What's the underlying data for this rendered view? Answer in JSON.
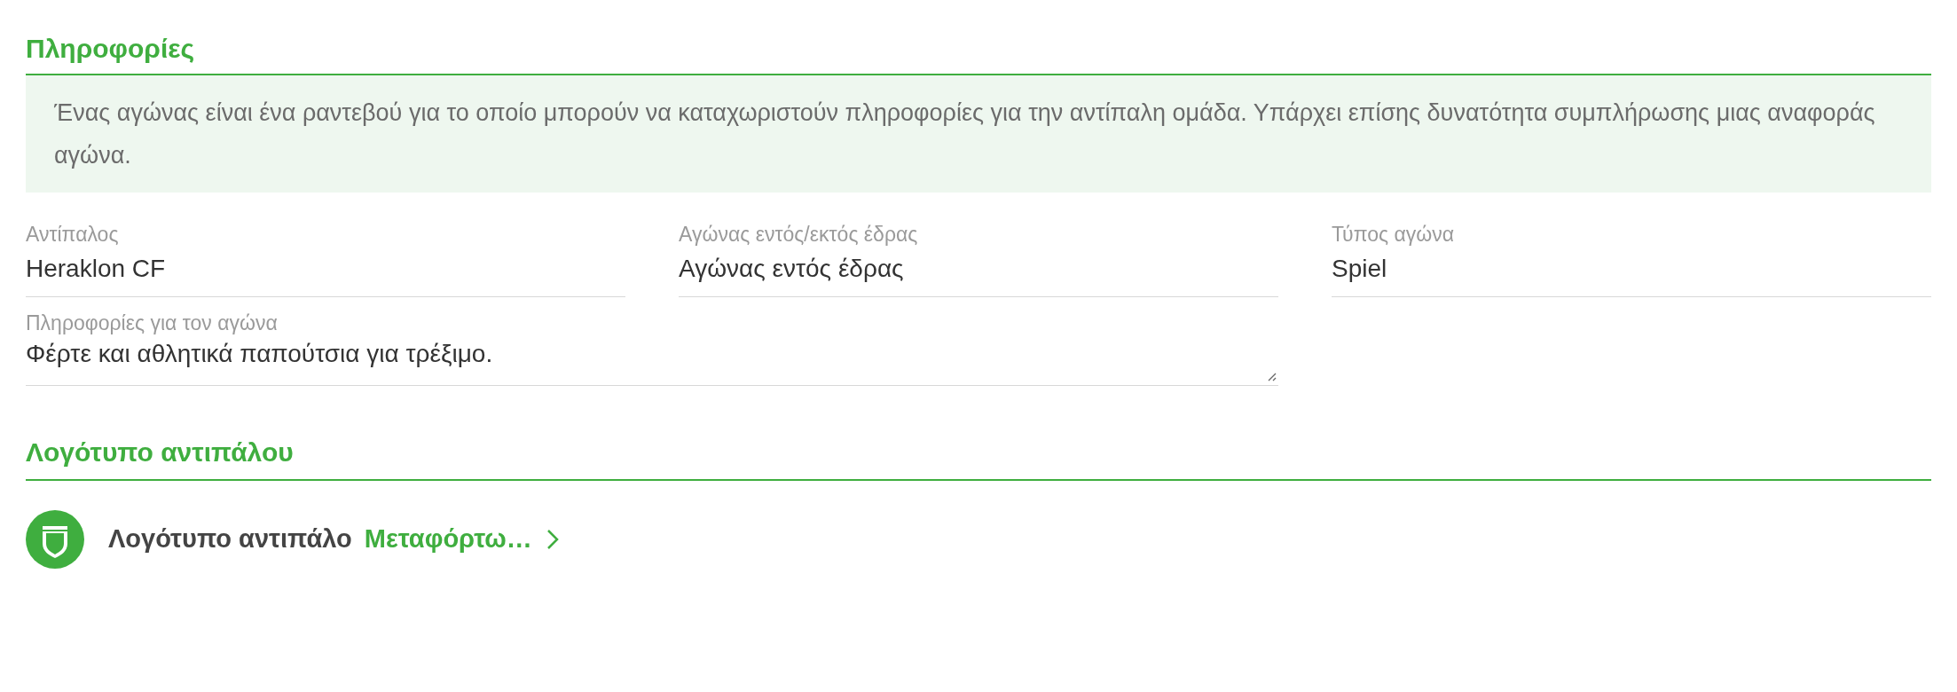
{
  "info_section": {
    "heading": "Πληροφορίες",
    "description": "Ένας αγώνας είναι ένα ραντεβού για το οποίο μπορούν να καταχωριστούν πληροφορίες για την αντίπαλη ομάδα. Υπάρχει επίσης δυνατότητα συμπλήρωσης μιας αναφοράς αγώνα."
  },
  "fields": [
    {
      "label": "Αντίπαλος",
      "value": "Heraklon CF"
    },
    {
      "label": "Αγώνας εντός/εκτός έδρας",
      "value": "Αγώνας εντός έδρας"
    },
    {
      "label": "Τύπος αγώνα",
      "value": "Spiel"
    }
  ],
  "notes_field": {
    "label": "Πληροφορίες για τον αγώνα",
    "value": "Φέρτε και αθλητικά παπούτσια για τρέξιμο."
  },
  "logo_section": {
    "heading": "Λογότυπο αντιπάλου",
    "label": "Λογότυπο αντιπάλο",
    "action": "Μεταφόρτω…"
  }
}
